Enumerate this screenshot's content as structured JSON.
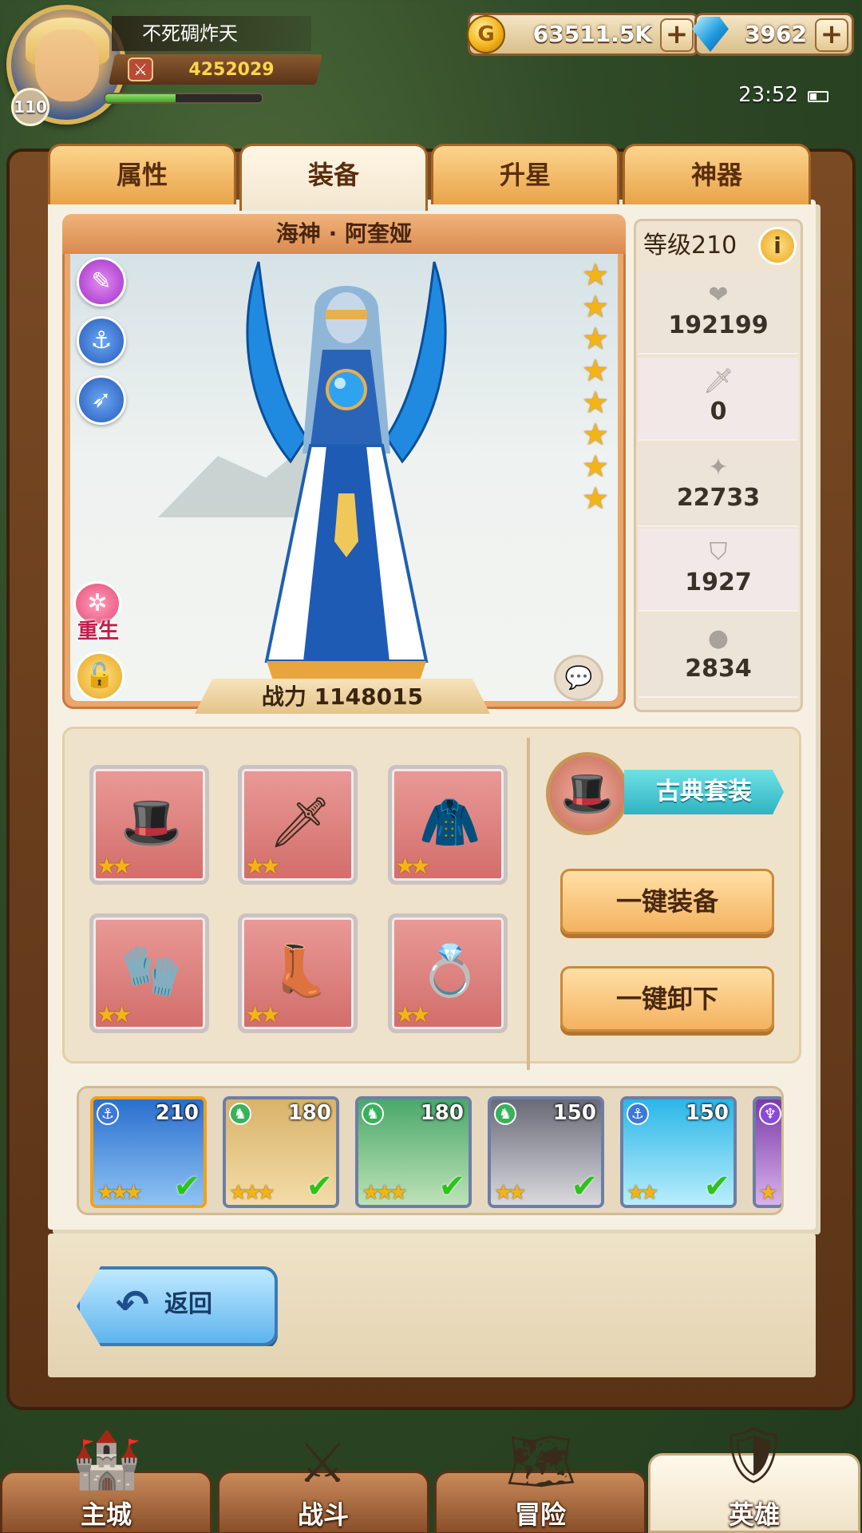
{
  "player": {
    "name": "不死碉炸天",
    "level": "110",
    "power": "4252029",
    "exp_fraction": 0.45
  },
  "resources": {
    "gold": "63511.5K",
    "gems": "3962"
  },
  "status": {
    "time": "23:52"
  },
  "tabs": [
    {
      "label": "属性",
      "active": false
    },
    {
      "label": "装备",
      "active": true
    },
    {
      "label": "升星",
      "active": false
    },
    {
      "label": "神器",
      "active": false
    }
  ],
  "hero": {
    "name": "海神 · 阿奎娅",
    "power_label": "战力 1148015",
    "star_count": 8,
    "rebirth_label": "重生",
    "level_label": "等级210"
  },
  "stats": [
    {
      "icon": "heart-icon",
      "value": "192199"
    },
    {
      "icon": "sword-icon",
      "value": "0"
    },
    {
      "icon": "magic-icon",
      "value": "22733"
    },
    {
      "icon": "shield-icon",
      "value": "1927"
    },
    {
      "icon": "drop-icon",
      "value": "2834"
    }
  ],
  "equipment": [
    {
      "name": "hat",
      "glyph": "🎩",
      "stars": "★★"
    },
    {
      "name": "dagger",
      "glyph": "🗡",
      "stars": "★★"
    },
    {
      "name": "robe",
      "glyph": "🧥",
      "stars": "★★"
    },
    {
      "name": "gloves",
      "glyph": "🧤",
      "stars": "★★"
    },
    {
      "name": "boots",
      "glyph": "👢",
      "stars": "★★"
    },
    {
      "name": "ring",
      "glyph": "💍",
      "stars": "★★"
    }
  ],
  "equip_set": {
    "label": "古典套装",
    "auto_equip": "一键装备",
    "auto_unequip": "一键卸下"
  },
  "roster": [
    {
      "level": "210",
      "stars": "★★★",
      "class_color": "#3b78d8",
      "class": "anchor-icon",
      "selected": true,
      "checked": true
    },
    {
      "level": "180",
      "stars": "★★★",
      "class_color": "#38b25a",
      "class": "beast-icon",
      "selected": false,
      "checked": true
    },
    {
      "level": "180",
      "stars": "★★★",
      "class_color": "#38b25a",
      "class": "beast-icon",
      "selected": false,
      "checked": true
    },
    {
      "level": "150",
      "stars": "★★",
      "class_color": "#38b25a",
      "class": "beast-icon",
      "selected": false,
      "checked": true
    },
    {
      "level": "150",
      "stars": "★★",
      "class_color": "#3b78d8",
      "class": "anchor-icon",
      "selected": false,
      "checked": true
    },
    {
      "level": "",
      "stars": "★",
      "class_color": "#8a4ad8",
      "class": "purple-icon",
      "selected": false,
      "checked": false
    }
  ],
  "back_label": "返回",
  "nav": [
    {
      "label": "主城",
      "icon": "castle-icon",
      "active": false
    },
    {
      "label": "战斗",
      "icon": "crossed-swords-icon",
      "active": false
    },
    {
      "label": "冒险",
      "icon": "map-icon",
      "active": false
    },
    {
      "label": "英雄",
      "icon": "hero-crest-icon",
      "active": true
    }
  ]
}
